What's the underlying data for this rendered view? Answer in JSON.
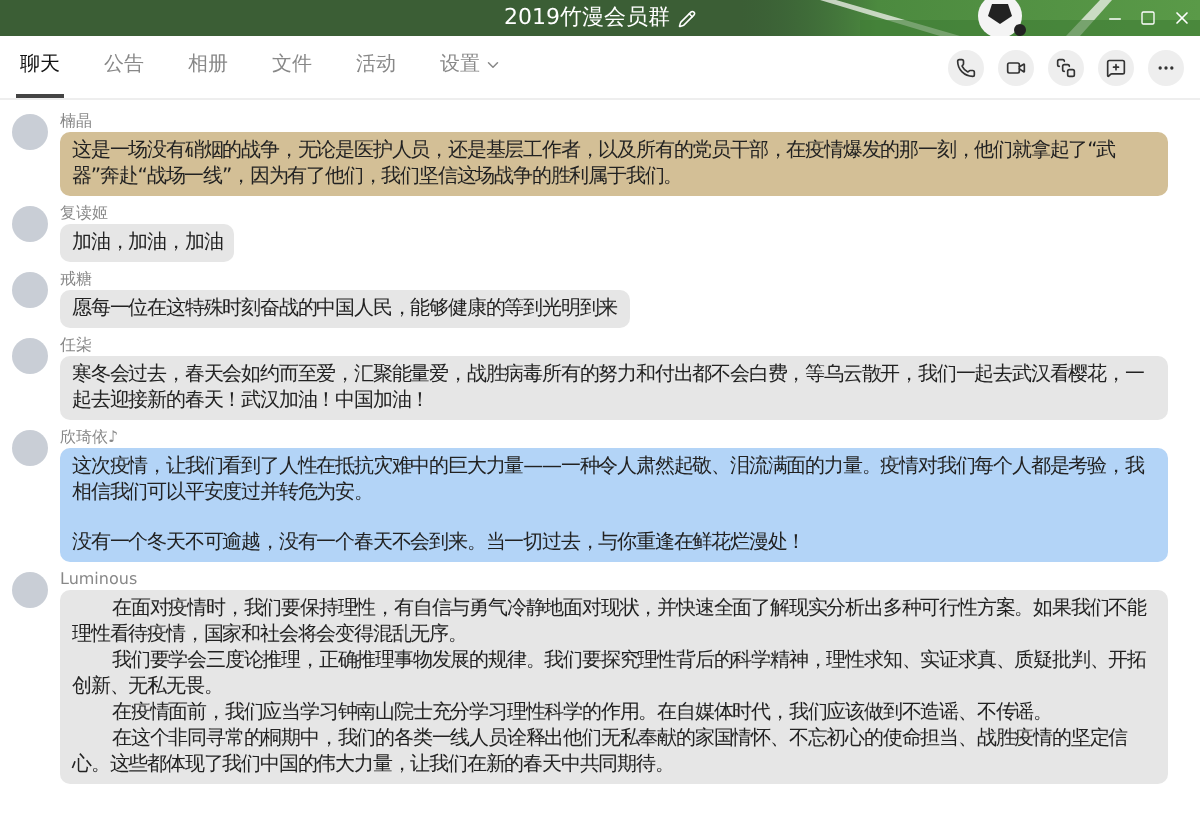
{
  "window": {
    "title": "2019竹漫会员群"
  },
  "tabs": [
    {
      "label": "聊天",
      "selected": true,
      "dropdown": false
    },
    {
      "label": "公告",
      "selected": false,
      "dropdown": false
    },
    {
      "label": "相册",
      "selected": false,
      "dropdown": false
    },
    {
      "label": "文件",
      "selected": false,
      "dropdown": false
    },
    {
      "label": "活动",
      "selected": false,
      "dropdown": false
    },
    {
      "label": "设置",
      "selected": false,
      "dropdown": true
    }
  ],
  "messages": [
    {
      "sender": "楠晶",
      "color": "#d3bf96",
      "paragraphs": [
        "这是一场没有硝烟的战争，无论是医护人员，还是基层工作者，以及所有的党员干部，在疫情爆发的那一刻，他们就拿起了“武器”奔赴“战场一线”，因为有了他们，我们坚信这场战争的胜利属于我们。"
      ]
    },
    {
      "sender": "复读姬",
      "color": "#e6e6e6",
      "paragraphs": [
        "加油，加油，加油"
      ]
    },
    {
      "sender": "戒糖",
      "color": "#e6e6e6",
      "paragraphs": [
        "愿每一位在这特殊时刻奋战的中国人民，能够健康的等到光明到来"
      ]
    },
    {
      "sender": "任柒",
      "color": "#e6e6e6",
      "paragraphs": [
        "寒冬会过去，春天会如约而至爱，汇聚能量爱，战胜病毒所有的努力和付出都不会白费，等乌云散开，我们一起去武汉看樱花，一起去迎接新的春天！武汉加油！中国加油！"
      ]
    },
    {
      "sender": "欣琦依♪",
      "color": "#b3d4f7",
      "paragraphs": [
        "这次疫情，让我们看到了人性在抵抗灾难中的巨大力量——一种令人肃然起敬、泪流满面的力量。疫情对我们每个人都是考验，我相信我们可以平安度过并转危为安。",
        "没有一个冬天不可逾越，没有一个春天不会到来。当一切过去，与你重逢在鲜花烂漫处！"
      ]
    },
    {
      "sender": "Luminous",
      "color": "#e6e6e6",
      "paragraphs": [
        "在面对疫情时，我们要保持理性，有自信与勇气冷静地面对现状，并快速全面了解现实分析出多种可行性方案。如果我们不能理性看待疫情，国家和社会将会变得混乱无序。",
        "我们要学会三度论推理，正确推理事物发展的规律。我们要探究理性背后的科学精神，理性求知、实证求真、质疑批判、开拓创新、无私无畏。",
        "在疫情面前，我们应当学习钟南山院士充分学习理性科学的作用。在自媒体时代，我们应该做到不造谣、不传谣。",
        "在这个非同寻常的桐期中，我们的各类一线人员诠释出他们无私奉献的家国情怀、不忘初心的使命担当、战胜疫情的坚定信心。这些都体现了我们中国的伟大力量，让我们在新的春天中共同期待。"
      ]
    }
  ]
}
